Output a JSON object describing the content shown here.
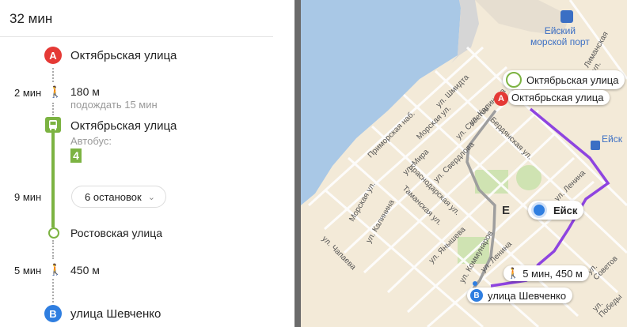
{
  "header": {
    "duration": "32 мин"
  },
  "route": {
    "start": {
      "marker": "A",
      "name": "Октябрьская улица"
    },
    "walk1": {
      "time": "2 мин",
      "distance": "180 м",
      "wait": "подождать 15 мин"
    },
    "bus_stop": {
      "name": "Октябрьская улица",
      "type": "Автобус:",
      "route_number": "4"
    },
    "ride": {
      "time": "9 мин",
      "stops_label": "6 остановок"
    },
    "exit_stop": {
      "name": "Ростовская улица"
    },
    "walk2": {
      "time": "5 мин",
      "distance": "450 м"
    },
    "end": {
      "marker": "B",
      "name": "улица Шевченко"
    }
  },
  "map": {
    "port_label": "Ейский\nморской порт",
    "station_label": "Ейск",
    "city_label": "Ейск",
    "city_letter": "Е",
    "bus_stop_label": "Октябрьская улица",
    "start_label": "Октябрьская улица",
    "walk_label": "5 мин, 450 м",
    "end_label": "улица Шевченко",
    "start_marker": "A",
    "end_marker": "B",
    "streets": [
      "ул. Шмидта",
      "ул. Калинина",
      "Приморская наб.",
      "Морская ул.",
      "ул. Советов",
      "Бердянская ул.",
      "ул. Мира",
      "ул. Свердлова",
      "Краснодарская ул.",
      "Таманская ул.",
      "Морская ул.",
      "ул. Калинина",
      "ул. Чапаева",
      "ул. Ленина",
      "ул. Янышева",
      "ул. Коммунаров",
      "Лиманская ул.",
      "ул. Советов",
      "ул. Победы",
      "ул. Ленина"
    ],
    "colors": {
      "sea": "#a9c8e6",
      "land": "#f3ead8",
      "walk_route": "#9e9e9e",
      "bus_route": "#8e44e0",
      "marker_a": "#e53935",
      "marker_b": "#2f7ee0",
      "bus_green": "#7cb342"
    }
  }
}
